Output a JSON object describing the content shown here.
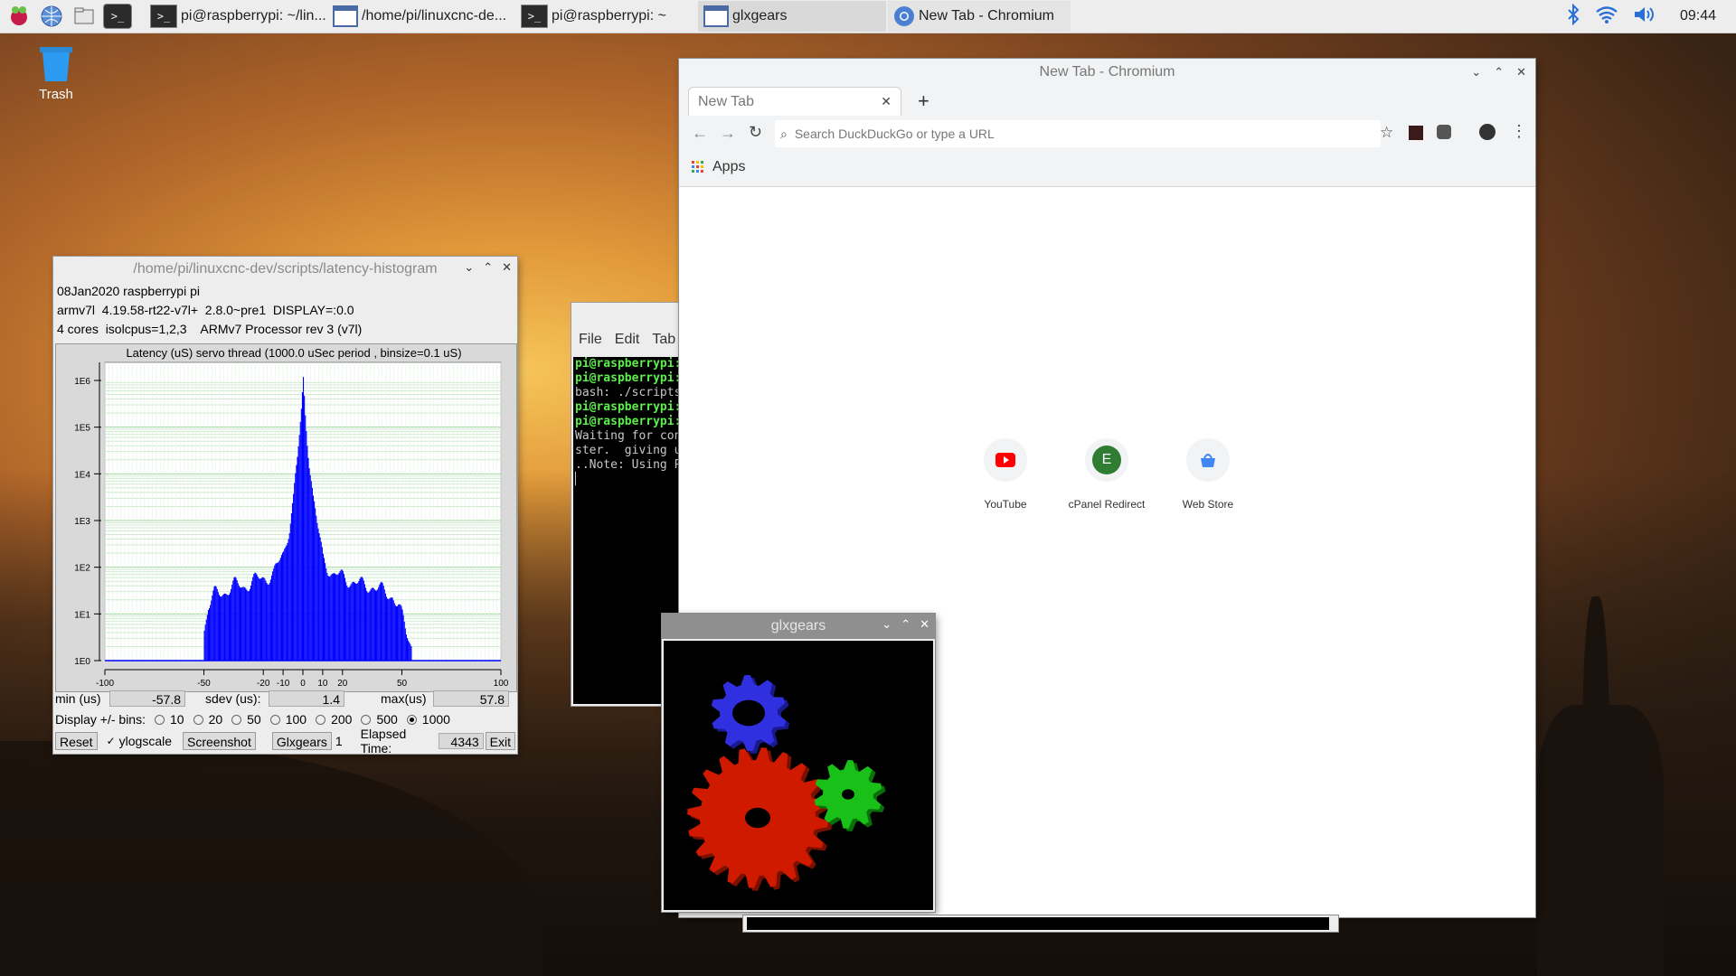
{
  "taskbar": {
    "tasks": [
      {
        "label": "pi@raspberrypi: ~/lin..."
      },
      {
        "label": "/home/pi/linuxcnc-de..."
      },
      {
        "label": "pi@raspberrypi: ~"
      },
      {
        "label": "glxgears"
      },
      {
        "label": "New Tab - Chromium"
      }
    ],
    "clock": "09:44"
  },
  "desktop": {
    "trash_label": "Trash"
  },
  "latency": {
    "title": "/home/pi/linuxcnc-dev/scripts/latency-histogram",
    "info": [
      "08Jan2020 raspberrypi pi",
      "armv7l  4.19.58-rt22-v7l+  2.8.0~pre1  DISPLAY=:0.0",
      "4 cores  isolcpus=1,2,3    ARMv7 Processor rev 3 (v7l)"
    ],
    "chart_title": "Latency (uS) servo thread (1000.0 uSec period , binsize=0.1 uS)",
    "min_label": "min (us)",
    "min_value": "-57.8",
    "sdev_label": "sdev (us):",
    "sdev_value": "1.4",
    "max_label": "max(us)",
    "max_value": "57.8",
    "bins_label": "Display +/- bins:",
    "bins": [
      "10",
      "20",
      "50",
      "100",
      "200",
      "500",
      "1000"
    ],
    "selected_bin": "1000",
    "reset_label": "Reset",
    "ylogscale_label": "ylogscale",
    "screenshot_label": "Screenshot",
    "glxgears_label": "Glxgears",
    "glxgears_count": "1",
    "elapsed_label": "Elapsed Time:",
    "elapsed_value": "4343",
    "exit_label": "Exit"
  },
  "chart_data": {
    "type": "bar",
    "title": "Latency (uS) servo thread (1000.0 uSec period , binsize=0.1 uS)",
    "xlabel": "",
    "ylabel": "",
    "log_y": true,
    "xlim": [
      -100,
      100
    ],
    "ylim": [
      1,
      1000000
    ],
    "x_ticks": [
      "-100",
      "-50",
      "-20",
      "-10",
      "0",
      "10",
      "20",
      "50",
      "100"
    ],
    "y_ticks": [
      "1E0",
      "1E1",
      "1E2",
      "1E3",
      "1E4",
      "1E5",
      "1E6"
    ],
    "color": "#0000ff",
    "grid": true,
    "series": [
      {
        "x": [
          -50,
          -48,
          -45,
          -40,
          -35,
          -30,
          -25,
          -20,
          -15,
          -10,
          -7,
          -5,
          -4,
          -3,
          -2,
          -1,
          0,
          1,
          2,
          3,
          4,
          5,
          7,
          10,
          15,
          20,
          25,
          30,
          35,
          40,
          45,
          48,
          50,
          52,
          55
        ],
        "values": [
          5,
          15,
          25,
          30,
          40,
          40,
          50,
          60,
          70,
          200,
          800,
          3000,
          8000,
          20000,
          60000,
          200000,
          1000000,
          200000,
          60000,
          20000,
          8000,
          3000,
          800,
          150,
          70,
          60,
          50,
          40,
          40,
          30,
          25,
          15,
          8,
          4,
          2
        ]
      }
    ]
  },
  "terminal": {
    "menu": [
      "File",
      "Edit",
      "Tab"
    ],
    "lines": [
      {
        "text": "pi@raspberrypi:",
        "green": true
      },
      {
        "text": "pi@raspberrypi:",
        "green": true
      },
      {
        "text": "bash: ./scripts",
        "green": false
      },
      {
        "text": "pi@raspberrypi:",
        "green": true
      },
      {
        "text": "pi@raspberrypi:",
        "green": true
      },
      {
        "text": "Waiting for con",
        "green": false
      },
      {
        "text": "ster.  giving u",
        "green": false
      },
      {
        "text": "..Note: Using P",
        "green": false
      }
    ]
  },
  "chromium": {
    "window_title": "New Tab - Chromium",
    "tab_title": "New Tab",
    "omnibox_placeholder": "Search DuckDuckGo or type a URL",
    "apps_label": "Apps",
    "shortcuts": [
      {
        "label": "YouTube",
        "letter": "",
        "color": "#ff0000"
      },
      {
        "label": "cPanel Redirect",
        "letter": "E",
        "color": "#2e7d32"
      },
      {
        "label": "Web Store",
        "letter": "",
        "color": "#4285f4"
      }
    ]
  },
  "glxgears": {
    "title": "glxgears"
  }
}
